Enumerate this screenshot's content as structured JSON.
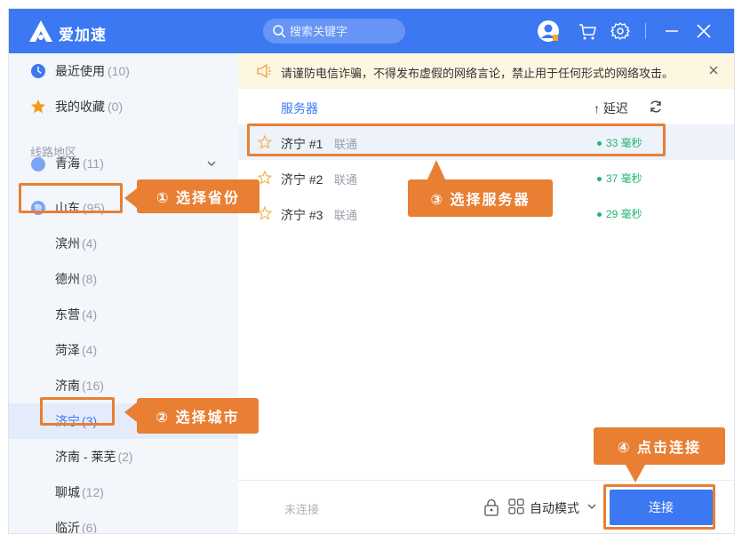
{
  "app": {
    "name": "爱加速"
  },
  "search": {
    "placeholder": "搜索关键字"
  },
  "sidebar": {
    "recent": {
      "label": "最近使用",
      "count": "(10)"
    },
    "favorites": {
      "label": "我的收藏",
      "count": "(0)"
    },
    "section_title": "线路地区",
    "provinces": [
      {
        "label": "青海",
        "count": "(11)"
      },
      {
        "label": "山东",
        "count": "(95)"
      }
    ],
    "cities": [
      {
        "label": "滨州",
        "count": "(4)"
      },
      {
        "label": "德州",
        "count": "(8)"
      },
      {
        "label": "东营",
        "count": "(4)"
      },
      {
        "label": "菏泽",
        "count": "(4)"
      },
      {
        "label": "济南",
        "count": "(16)"
      },
      {
        "label": "济宁",
        "count": "(3)"
      },
      {
        "label": "济南 - 莱芜",
        "count": "(2)"
      },
      {
        "label": "聊城",
        "count": "(12)"
      },
      {
        "label": "临沂",
        "count": "(6)"
      }
    ]
  },
  "notice": {
    "text": "请谨防电信诈骗，不得发布虚假的网络言论，禁止用于任何形式的网络攻击。"
  },
  "list": {
    "header_server": "服务器",
    "header_latency": "↑ 延迟",
    "servers": [
      {
        "name": "济宁 #1",
        "isp": "联通",
        "latency": "33 毫秒"
      },
      {
        "name": "济宁 #2",
        "isp": "联通",
        "latency": "37 毫秒"
      },
      {
        "name": "济宁 #3",
        "isp": "联通",
        "latency": "29 毫秒"
      }
    ]
  },
  "footer": {
    "status": "未连接",
    "mode": "自动模式",
    "connect_label": "连接"
  },
  "tutorial": {
    "step1": "① 选择省份",
    "step2": "② 选择城市",
    "step3": "③ 选择服务器",
    "step4": "④ 点击连接"
  },
  "colors": {
    "brand": "#3b78f2",
    "accent": "#e87f32",
    "latency": "#22b573"
  }
}
